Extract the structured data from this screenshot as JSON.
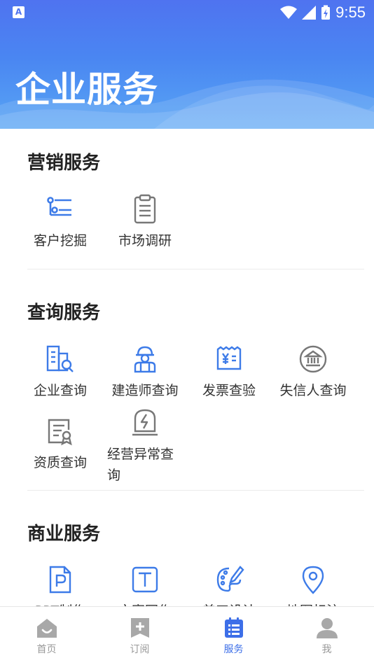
{
  "status_bar": {
    "time": "9:55",
    "left_badge": "A"
  },
  "header": {
    "title": "企业服务"
  },
  "sections": [
    {
      "title": "营销服务",
      "items": [
        {
          "label": "客户挖掘",
          "icon": "list-filter-icon"
        },
        {
          "label": "市场调研",
          "icon": "clipboard-icon"
        }
      ]
    },
    {
      "title": "查询服务",
      "items": [
        {
          "label": "企业查询",
          "icon": "building-search-icon"
        },
        {
          "label": "建造师查询",
          "icon": "builder-icon"
        },
        {
          "label": "发票查验",
          "icon": "invoice-icon"
        },
        {
          "label": "失信人查询",
          "icon": "bank-icon"
        },
        {
          "label": "资质查询",
          "icon": "certificate-icon"
        },
        {
          "label": "经营异常查询",
          "icon": "alert-stamp-icon"
        }
      ]
    },
    {
      "title": "商业服务",
      "items": [
        {
          "label": "PPT制作",
          "icon": "ppt-icon"
        },
        {
          "label": "文案写作",
          "icon": "text-icon"
        },
        {
          "label": "美工设计",
          "icon": "palette-icon"
        },
        {
          "label": "地图标注",
          "icon": "map-pin-icon"
        }
      ]
    }
  ],
  "tabbar": [
    {
      "label": "首页",
      "icon": "home-icon",
      "active": false
    },
    {
      "label": "订阅",
      "icon": "subscribe-plus-icon",
      "active": false
    },
    {
      "label": "服务",
      "icon": "service-list-icon",
      "active": true
    },
    {
      "label": "我",
      "icon": "person-icon",
      "active": false
    }
  ],
  "colors": {
    "accent": "#3d6fe8",
    "icon_blue": "#3d7be8",
    "icon_gray": "#777777",
    "header_top": "#4f73f0"
  }
}
